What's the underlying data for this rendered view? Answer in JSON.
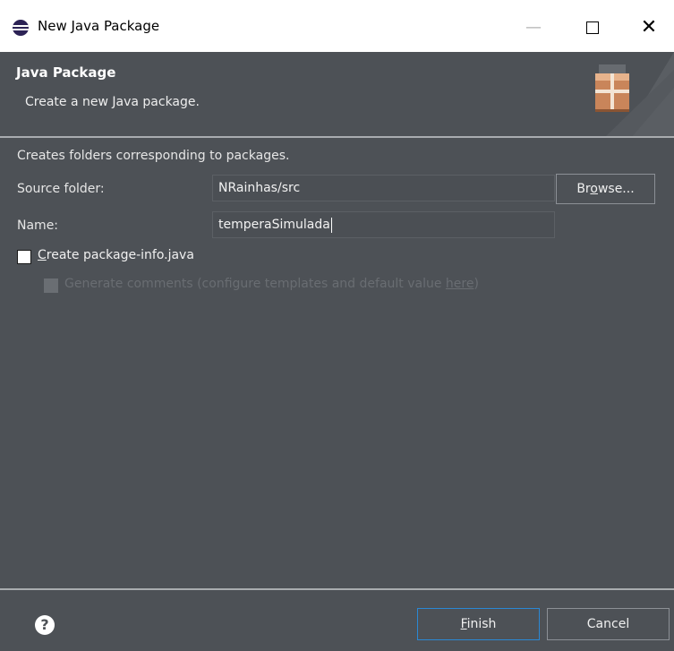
{
  "window": {
    "title": "New Java Package",
    "minimize_glyph": "—",
    "close_glyph": "✕"
  },
  "banner": {
    "title": "Java Package",
    "description": "Create a new Java package."
  },
  "content": {
    "info": "Creates folders corresponding to packages.",
    "source_folder_label": "Source folder:",
    "source_folder_value": "NRainhas/src",
    "browse_pre": "Br",
    "browse_mnemonic": "o",
    "browse_post": "wse...",
    "name_label": "Name:",
    "name_value": "temperaSimulada",
    "create_pkg_info_mnemonic": "C",
    "create_pkg_info_rest": "reate package-info.java",
    "generate_comments_text": "Generate comments (configure templates and default value ",
    "here_link": "here",
    "generate_comments_suffix": ")"
  },
  "footer": {
    "help_glyph": "?",
    "finish_mnemonic": "F",
    "finish_rest": "inish",
    "cancel": "Cancel"
  },
  "colors": {
    "background": "#4d5156",
    "titlebar": "#ffffff",
    "default_button_border": "#2a88d4",
    "separator": "#a9acaf"
  }
}
